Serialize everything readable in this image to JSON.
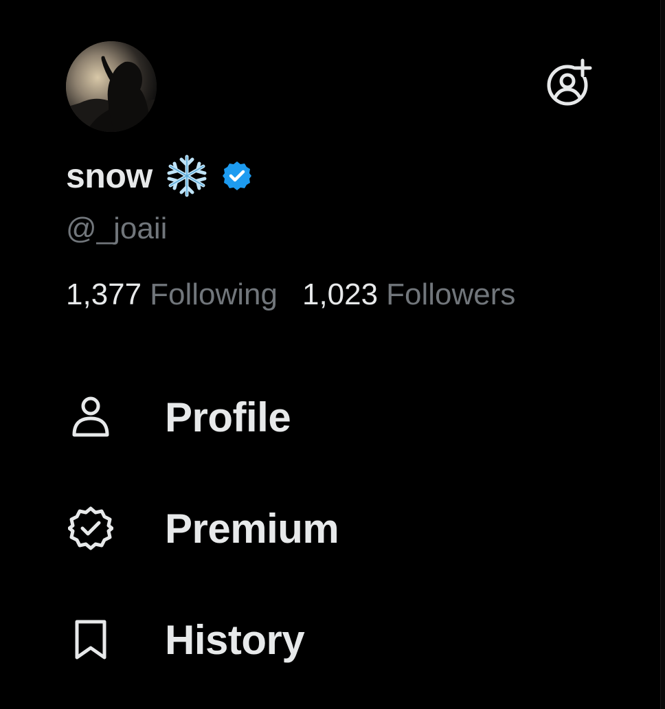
{
  "account": {
    "display_name": "snow",
    "name_emoji": "snowflake-emoji",
    "verified": true,
    "verified_color": "#1d9bf0",
    "handle": "@_joaii"
  },
  "stats": {
    "following_count": "1,377",
    "following_label": "Following",
    "followers_count": "1,023",
    "followers_label": "Followers"
  },
  "menu": [
    {
      "label": "Profile",
      "icon": "person-icon"
    },
    {
      "label": "Premium",
      "icon": "verified-badge-icon"
    },
    {
      "label": "History",
      "icon": "bookmark-icon"
    }
  ],
  "header": {
    "add_account_icon": "add-account-icon"
  },
  "colors": {
    "background": "#000000",
    "text_primary": "#e7e9ea",
    "text_secondary": "#71767b",
    "accent": "#1d9bf0"
  }
}
